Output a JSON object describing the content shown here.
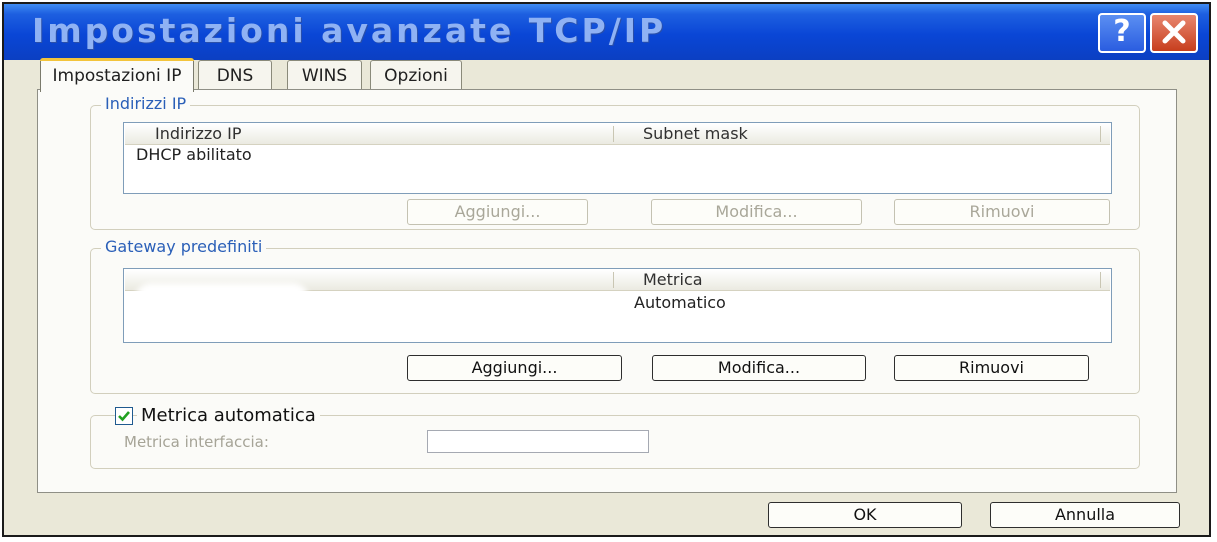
{
  "window": {
    "title": "Impostazioni avanzate TCP/IP",
    "help_label": "?",
    "close_label": "X"
  },
  "tabs": [
    {
      "label": "Impostazioni IP",
      "active": true
    },
    {
      "label": "DNS",
      "active": false
    },
    {
      "label": "WINS",
      "active": false
    },
    {
      "label": "Opzioni",
      "active": false
    }
  ],
  "ip_addresses": {
    "legend": "Indirizzi IP",
    "columns": [
      "Indirizzo IP",
      "Subnet mask"
    ],
    "rows": [
      [
        "DHCP abilitato",
        ""
      ]
    ],
    "buttons": {
      "add": "Aggiungi...",
      "edit": "Modifica...",
      "remove": "Rimuovi"
    },
    "buttons_enabled": false
  },
  "gateways": {
    "legend": "Gateway predefiniti",
    "columns": [
      "",
      "Metrica"
    ],
    "rows": [
      [
        "",
        "Automatico"
      ]
    ],
    "buttons": {
      "add": "Aggiungi...",
      "edit": "Modifica...",
      "remove": "Rimuovi"
    },
    "buttons_enabled": true
  },
  "metric": {
    "automatic_label": "Metrica automatica",
    "automatic_checked": true,
    "interface_label": "Metrica interfaccia:",
    "interface_value": "",
    "interface_enabled": false
  },
  "footer": {
    "ok_label": "OK",
    "cancel_label": "Annulla"
  },
  "colors": {
    "titlebar": "#0a46d6",
    "title_text": "#8fb2f4",
    "group_legend": "#2a5fb8",
    "checkbox_check": "#21a121",
    "active_tab_accent": "#f3c43c"
  }
}
